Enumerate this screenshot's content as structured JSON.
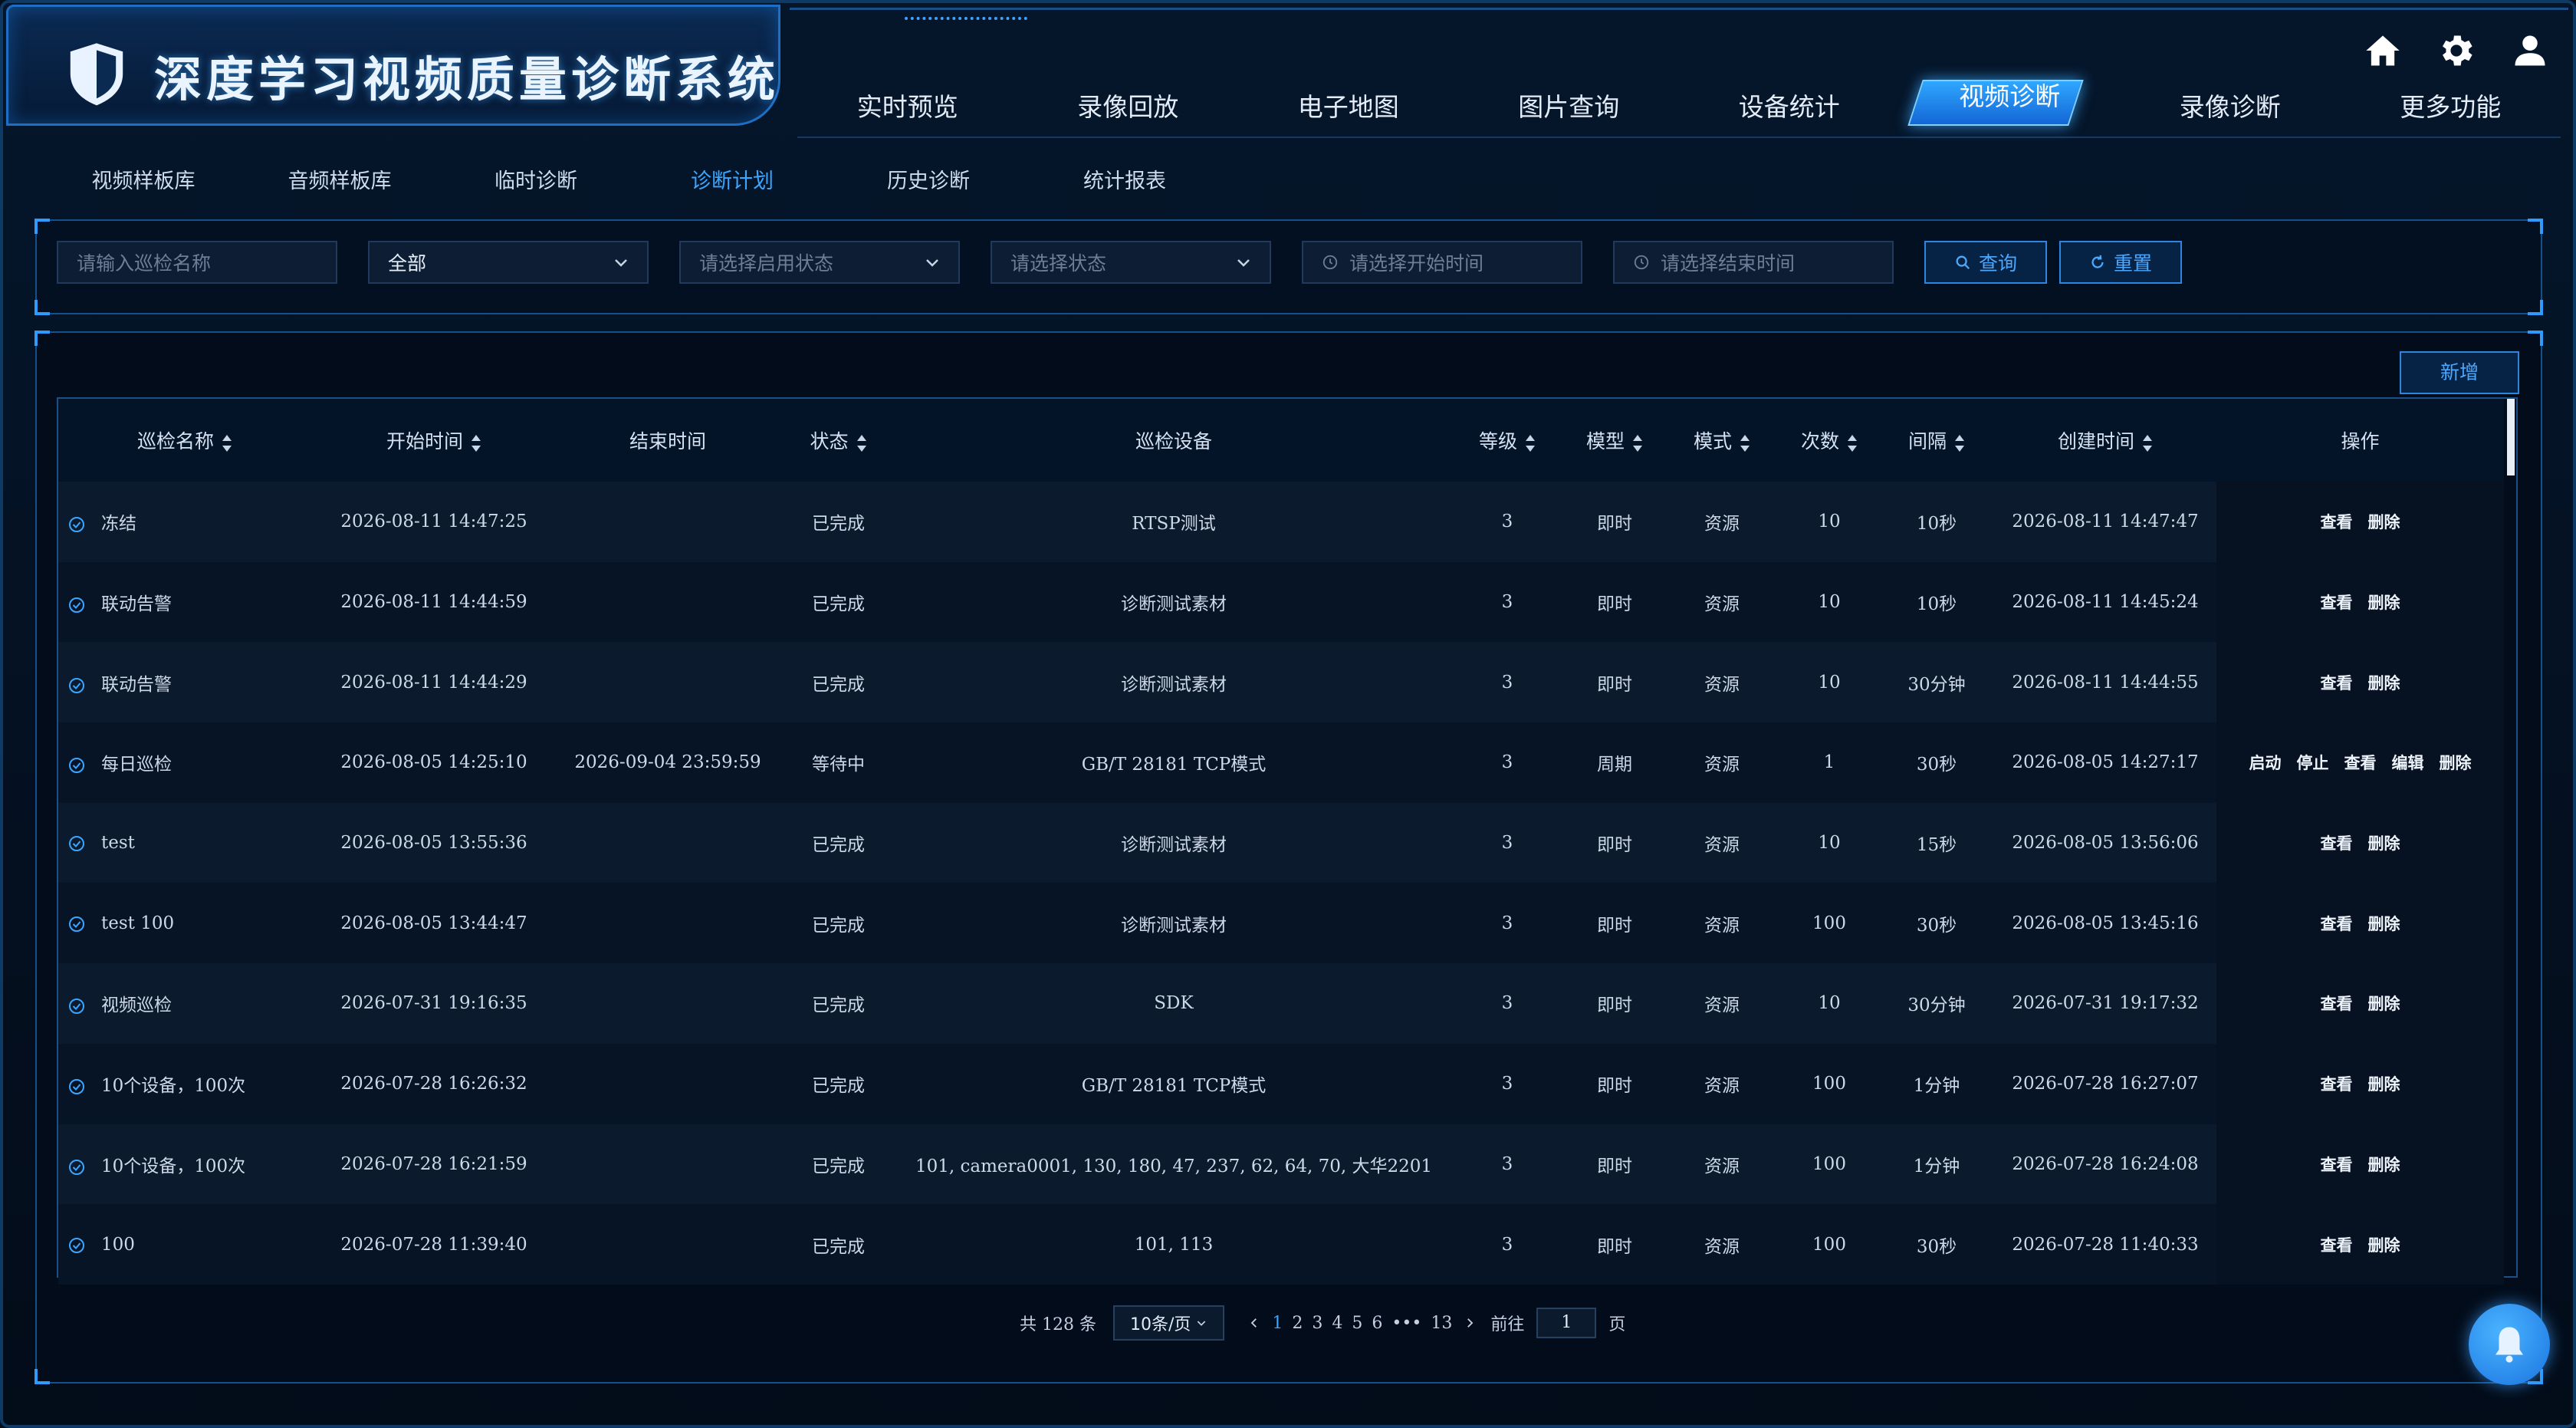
{
  "app": {
    "title": "深度学习视频质量诊断系统"
  },
  "colors": {
    "accent": "#3aa6ff",
    "panel_border": "#16508a",
    "active_nav": "#2fa7ff"
  },
  "main_nav": [
    {
      "label": "实时预览",
      "active": false
    },
    {
      "label": "录像回放",
      "active": false
    },
    {
      "label": "电子地图",
      "active": false
    },
    {
      "label": "图片查询",
      "active": false
    },
    {
      "label": "设备统计",
      "active": false
    },
    {
      "label": "视频诊断",
      "active": true
    },
    {
      "label": "录像诊断",
      "active": false
    },
    {
      "label": "更多功能",
      "active": false
    }
  ],
  "header_icons": [
    "home-icon",
    "gear-icon",
    "user-icon"
  ],
  "sub_tabs": [
    {
      "label": "视频样板库",
      "active": false
    },
    {
      "label": "音频样板库",
      "active": false
    },
    {
      "label": "临时诊断",
      "active": false
    },
    {
      "label": "诊断计划",
      "active": true
    },
    {
      "label": "历史诊断",
      "active": false
    },
    {
      "label": "统计报表",
      "active": false
    }
  ],
  "filters": {
    "name_placeholder": "请输入巡检名称",
    "category_value": "全部",
    "enable_placeholder": "请选择启用状态",
    "status_placeholder": "请选择状态",
    "start_placeholder": "请选择开始时间",
    "end_placeholder": "请选择结束时间",
    "query_label": "查询",
    "reset_label": "重置"
  },
  "table": {
    "add_label": "新增",
    "columns": [
      "巡检名称",
      "开始时间",
      "结束时间",
      "状态",
      "巡检设备",
      "等级",
      "模型",
      "模式",
      "次数",
      "间隔",
      "创建时间",
      "操作"
    ],
    "rows": [
      {
        "name": "冻结",
        "start": "2026-08-11 14:47:25",
        "end": "",
        "status": "已完成",
        "device": "RTSP测试",
        "level": "3",
        "model": "即时",
        "mode": "资源",
        "count": "10",
        "interval": "10秒",
        "created": "2026-08-11 14:47:47",
        "ops": [
          "查看",
          "删除"
        ]
      },
      {
        "name": "联动告警",
        "start": "2026-08-11 14:44:59",
        "end": "",
        "status": "已完成",
        "device": "诊断测试素材",
        "level": "3",
        "model": "即时",
        "mode": "资源",
        "count": "10",
        "interval": "10秒",
        "created": "2026-08-11 14:45:24",
        "ops": [
          "查看",
          "删除"
        ]
      },
      {
        "name": "联动告警",
        "start": "2026-08-11 14:44:29",
        "end": "",
        "status": "已完成",
        "device": "诊断测试素材",
        "level": "3",
        "model": "即时",
        "mode": "资源",
        "count": "10",
        "interval": "30分钟",
        "created": "2026-08-11 14:44:55",
        "ops": [
          "查看",
          "删除"
        ]
      },
      {
        "name": "每日巡检",
        "start": "2026-08-05 14:25:10",
        "end": "2026-09-04 23:59:59",
        "status": "等待中",
        "device": "GB/T 28181 TCP模式",
        "level": "3",
        "model": "周期",
        "mode": "资源",
        "count": "1",
        "interval": "30秒",
        "created": "2026-08-05 14:27:17",
        "ops": [
          "启动",
          "停止",
          "查看",
          "编辑",
          "删除"
        ]
      },
      {
        "name": "test",
        "start": "2026-08-05 13:55:36",
        "end": "",
        "status": "已完成",
        "device": "诊断测试素材",
        "level": "3",
        "model": "即时",
        "mode": "资源",
        "count": "10",
        "interval": "15秒",
        "created": "2026-08-05 13:56:06",
        "ops": [
          "查看",
          "删除"
        ]
      },
      {
        "name": "test 100",
        "start": "2026-08-05 13:44:47",
        "end": "",
        "status": "已完成",
        "device": "诊断测试素材",
        "level": "3",
        "model": "即时",
        "mode": "资源",
        "count": "100",
        "interval": "30秒",
        "created": "2026-08-05 13:45:16",
        "ops": [
          "查看",
          "删除"
        ]
      },
      {
        "name": "视频巡检",
        "start": "2026-07-31 19:16:35",
        "end": "",
        "status": "已完成",
        "device": "SDK",
        "level": "3",
        "model": "即时",
        "mode": "资源",
        "count": "10",
        "interval": "30分钟",
        "created": "2026-07-31 19:17:32",
        "ops": [
          "查看",
          "删除"
        ]
      },
      {
        "name": "10个设备，100次",
        "start": "2026-07-28 16:26:32",
        "end": "",
        "status": "已完成",
        "device": "GB/T 28181 TCP模式",
        "level": "3",
        "model": "即时",
        "mode": "资源",
        "count": "100",
        "interval": "1分钟",
        "created": "2026-07-28 16:27:07",
        "ops": [
          "查看",
          "删除"
        ]
      },
      {
        "name": "10个设备，100次",
        "start": "2026-07-28 16:21:59",
        "end": "",
        "status": "已完成",
        "device": "101, camera0001, 130, 180, 47, 237, 62, 64, 70, 大华2201",
        "level": "3",
        "model": "即时",
        "mode": "资源",
        "count": "100",
        "interval": "1分钟",
        "created": "2026-07-28 16:24:08",
        "ops": [
          "查看",
          "删除"
        ]
      },
      {
        "name": "100",
        "start": "2026-07-28 11:39:40",
        "end": "",
        "status": "已完成",
        "device": "101, 113",
        "level": "3",
        "model": "即时",
        "mode": "资源",
        "count": "100",
        "interval": "30秒",
        "created": "2026-07-28 11:40:33",
        "ops": [
          "查看",
          "删除"
        ]
      }
    ]
  },
  "pagination": {
    "total": "共 128 条",
    "page_size": "10条/页",
    "pages": [
      "1",
      "2",
      "3",
      "4",
      "5",
      "6",
      "•••",
      "13"
    ],
    "current": "1",
    "goto_prefix": "前往",
    "goto_value": "1",
    "goto_suffix": "页"
  }
}
